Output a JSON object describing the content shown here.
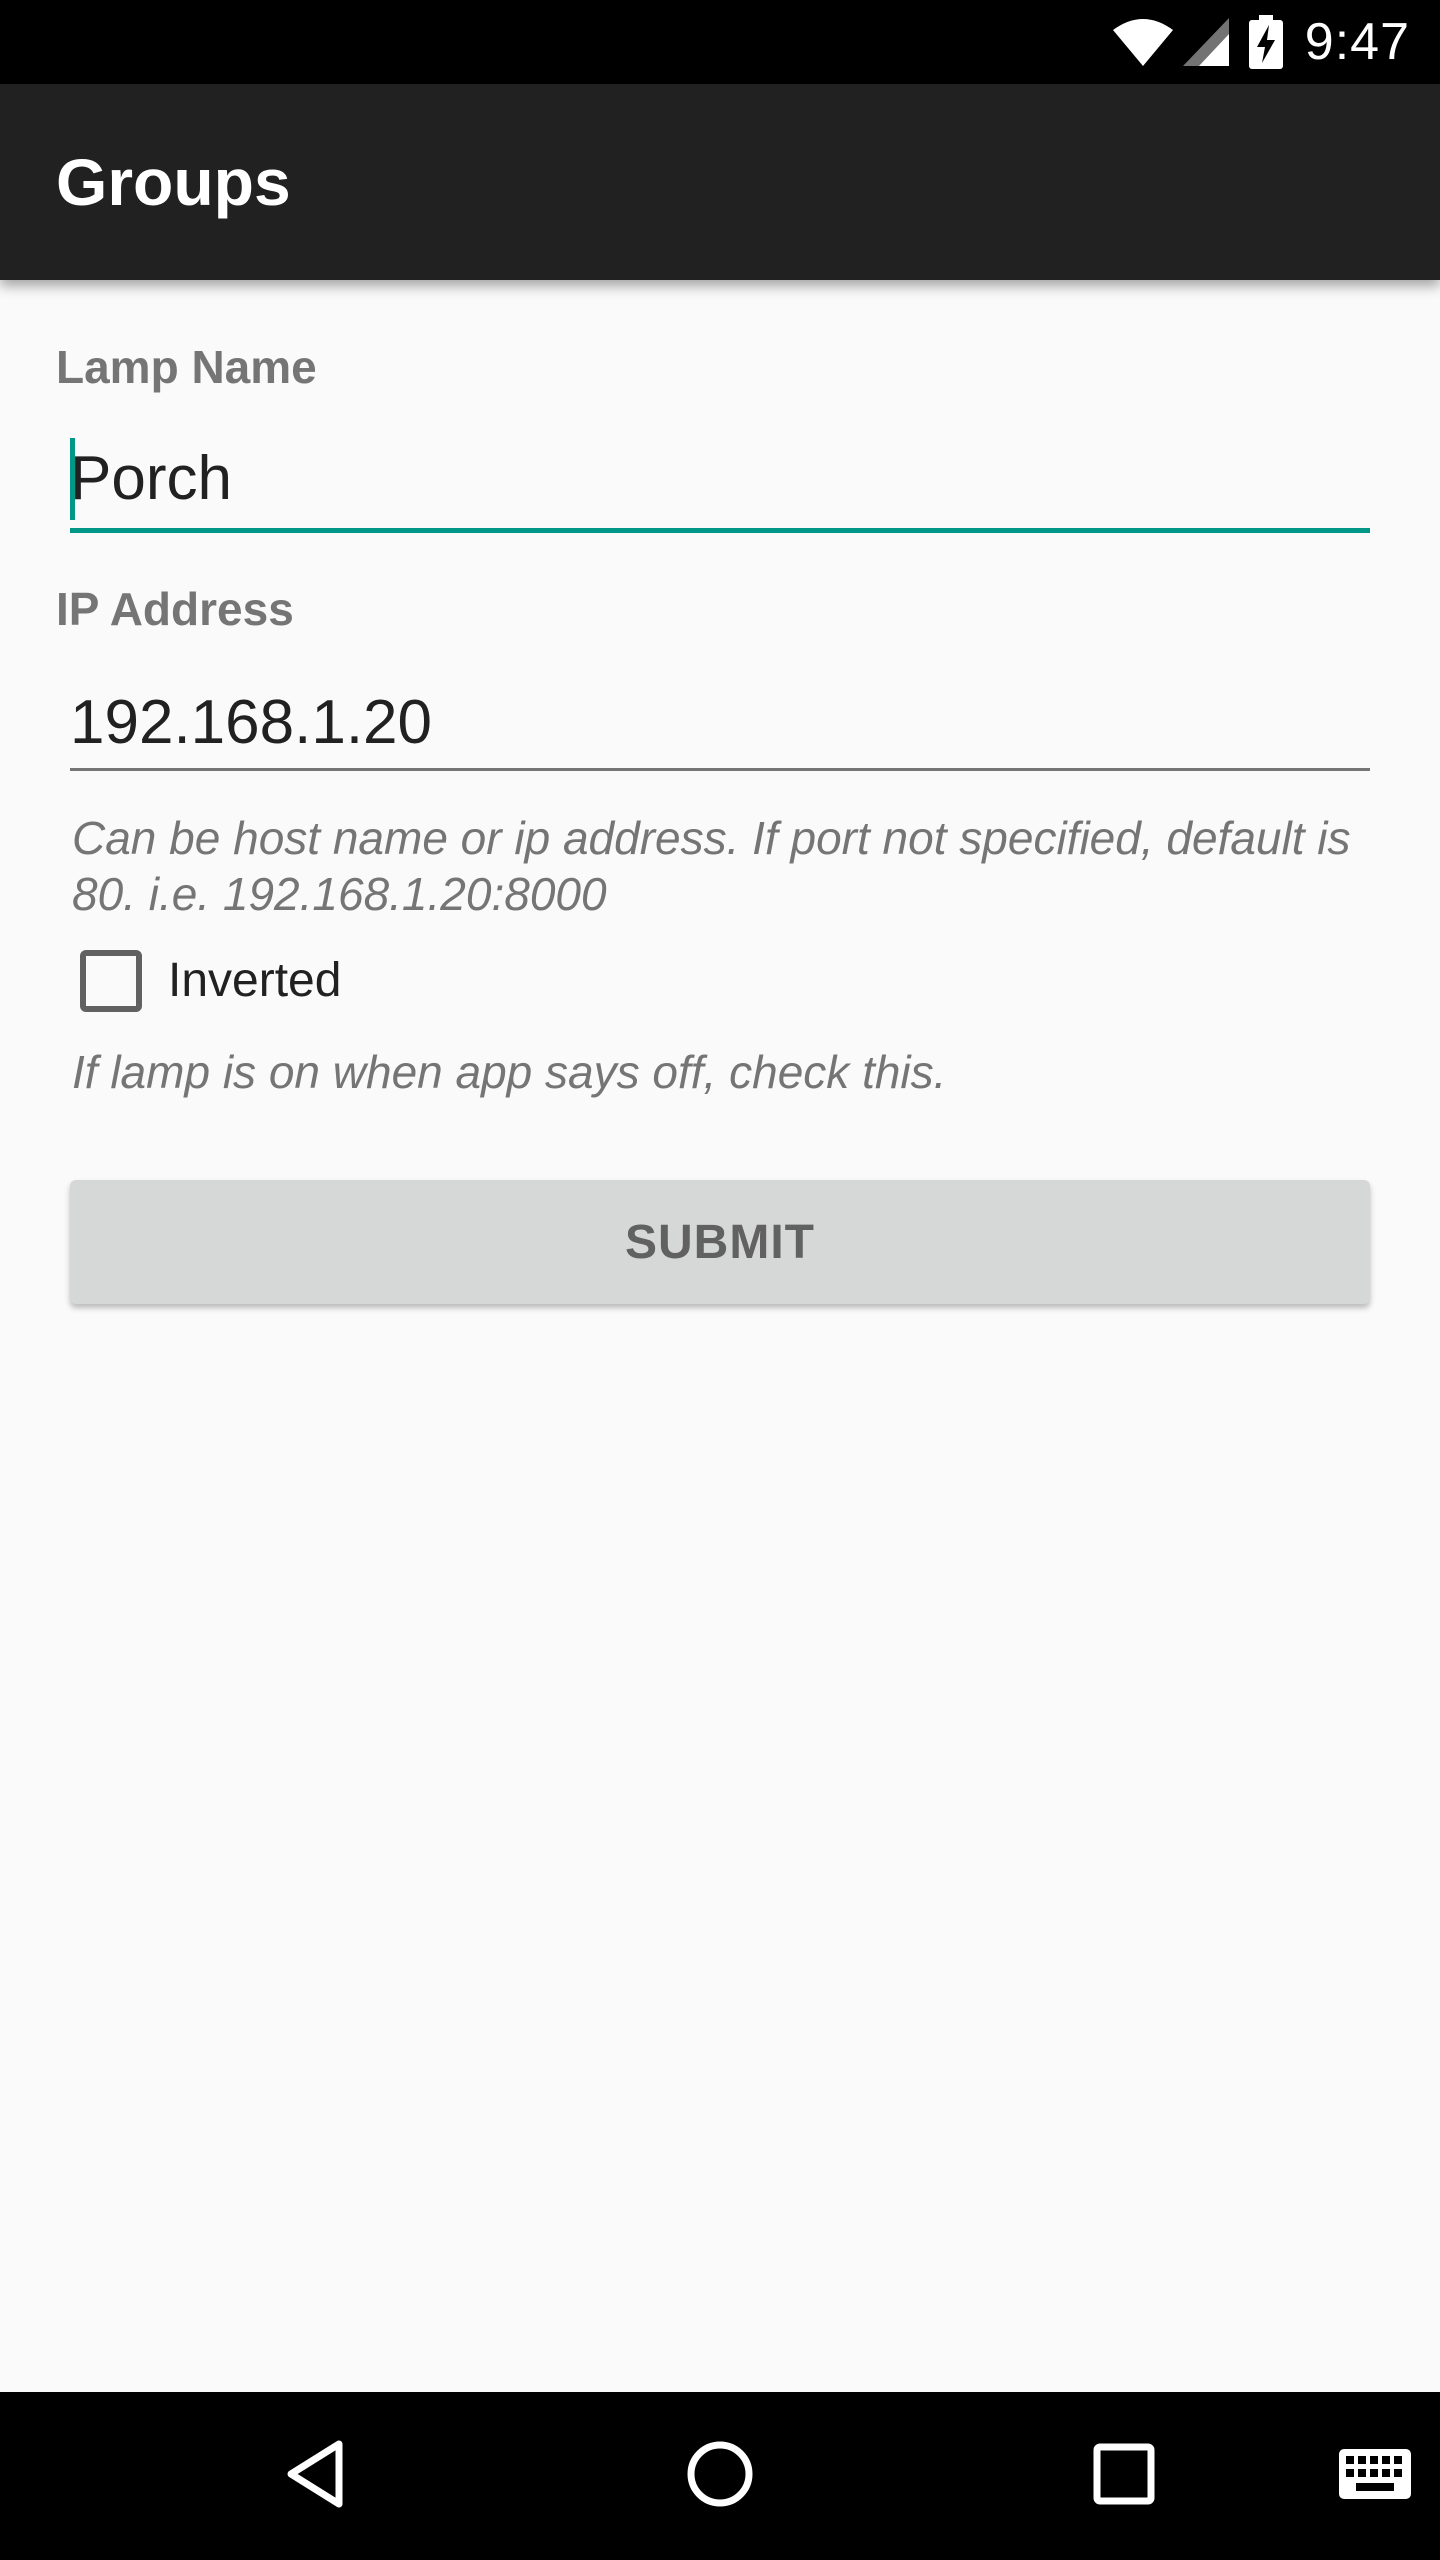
{
  "status_bar": {
    "time": "9:47",
    "icons": [
      "wifi-icon",
      "cell-signal-icon",
      "battery-charging-icon"
    ]
  },
  "app_bar": {
    "title": "Groups"
  },
  "form": {
    "lamp_name": {
      "label": "Lamp Name",
      "value": "Porch"
    },
    "ip_address": {
      "label": "IP Address",
      "value": "192.168.1.20",
      "helper": "Can be host name or ip address. If port not specified, default is 80. i.e. 192.168.1.20:8000"
    },
    "inverted": {
      "label": "Inverted",
      "checked": false,
      "helper": "If lamp is on when app says off, check this."
    },
    "submit_label": "SUBMIT"
  },
  "nav_bar": {
    "icons": [
      "back-icon",
      "home-icon",
      "recents-icon",
      "keyboard-icon"
    ]
  },
  "colors": {
    "accent": "#009688",
    "app_bar": "#212121",
    "background": "#fafafa",
    "button": "#d6d7d7"
  }
}
